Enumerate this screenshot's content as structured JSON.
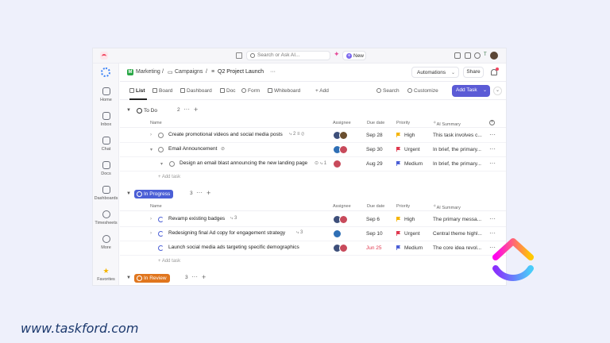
{
  "topbar": {
    "search_placeholder": "Search or Ask AI...",
    "new_label": "New"
  },
  "sidebar": {
    "items": [
      {
        "label": "Home",
        "icon": "home-icon"
      },
      {
        "label": "Inbox",
        "icon": "inbox-icon"
      },
      {
        "label": "Chat",
        "icon": "chat-icon"
      },
      {
        "label": "Docs",
        "icon": "docs-icon"
      },
      {
        "label": "Dashboards",
        "icon": "dashboards-icon"
      },
      {
        "label": "Timesheets",
        "icon": "timesheets-icon"
      },
      {
        "label": "More",
        "icon": "more-icon"
      },
      {
        "label": "Favorites",
        "icon": "star-icon"
      }
    ]
  },
  "breadcrumb": {
    "space_initial": "M",
    "space": "Marketing",
    "folder": "Campaigns",
    "list": "Q2 Project Launch",
    "more": "···"
  },
  "header_actions": {
    "automations": "Automations",
    "share": "Share"
  },
  "views": {
    "list": "List",
    "board": "Board",
    "dashboard": "Dashboard",
    "doc": "Doc",
    "form": "Form",
    "whiteboard": "Whiteboard",
    "add": "+ Add",
    "search": "Search",
    "customize": "Customize",
    "add_task": "Add Task"
  },
  "columns": {
    "name": "Name",
    "assignee": "Assignee",
    "due_date": "Due date",
    "priority": "Priority",
    "ai_summary": "AI Summary"
  },
  "groups": {
    "todo": {
      "label": "To Do",
      "count": "2",
      "tasks": [
        {
          "name": "Create promotional videos and social media posts",
          "meta": "⤷ 2 ≡ ⊘",
          "due": "Sep 28",
          "priority": "High",
          "ai": "This task involves c..."
        },
        {
          "name": "Email Announcement",
          "meta": "⊘",
          "due": "Sep 30",
          "priority": "Urgent",
          "ai": "In brief, the primary..."
        },
        {
          "name": "Design an email blast announcing the new landing page",
          "meta": "⊙ ⤷ 1",
          "due": "Aug 29",
          "priority": "Medium",
          "ai": "In brief, the primary..."
        }
      ],
      "add_task": "+ Add task"
    },
    "in_progress": {
      "label": "In Progress",
      "count": "3",
      "tasks": [
        {
          "name": "Revamp existing badges",
          "meta": "⤷ 3",
          "due": "Sep 6",
          "priority": "High",
          "ai": "The primary messa..."
        },
        {
          "name": "Redesigning final Ad copy for engagement strategy",
          "meta": "⤷ 3",
          "due": "Sep 10",
          "priority": "Urgent",
          "ai": "Central theme highl..."
        },
        {
          "name": "Launch social media ads targeting specific demographics",
          "meta": "",
          "due": "Jun 25",
          "priority": "Medium",
          "ai": "The core idea revol..."
        }
      ],
      "add_task": "+ Add task"
    },
    "in_review": {
      "label": "In Review",
      "count": "3"
    }
  },
  "priority_colors": {
    "High": "#f5b400",
    "Urgent": "#e0394f",
    "Medium": "#4b5fd6"
  },
  "footer": {
    "url": "www.taskford.com"
  }
}
